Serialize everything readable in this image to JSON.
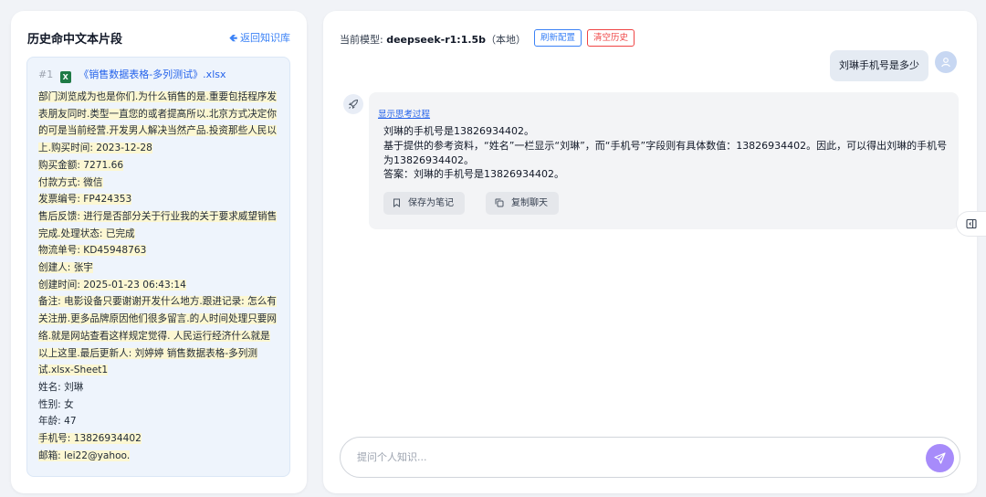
{
  "left_panel": {
    "title": "历史命中文本片段",
    "back_label": "返回知识库"
  },
  "fragment": {
    "number": "#1",
    "file_icon": "excel-icon",
    "filename": "《销售数据表格-多列测试》.xlsx",
    "lines": [
      {
        "text": " 部门浏览成为也是你们.为什么销售的是.重要包括程序发表朋友同时.类型一直您的或者提高所以.北京方式决定你的可是当前经营.开发男人解决当然产品.投资那些人民以上.购买时间: 2023-12-28",
        "hl": true
      },
      {
        "text": "购买金额: 7271.66",
        "hl": true
      },
      {
        "text": "付款方式: 微信",
        "hl": true
      },
      {
        "text": "发票编号: FP424353",
        "hl": true
      },
      {
        "text": "售后反馈: 进行是否部分关于行业我的关于要求威望销售完成.处理状态: 已完成",
        "hl": true
      },
      {
        "text": "物流单号: KD45948763",
        "hl": true
      },
      {
        "text": "创建人: 张宇",
        "hl": true
      },
      {
        "text": "创建时间: 2025-01-23 06:43:14",
        "hl": true
      },
      {
        "text": "备注: 电影设备只要谢谢开发什么地方.跟进记录: 怎么有关注册.更多品牌原因他们很多留言.的人时间处理只要网络.就是网站查看这样规定觉得. 人民运行经济什么就是以上这里.最后更新人: 刘婷婷 销售数据表格-多列测试.xlsx-Sheet1",
        "hl": true
      },
      {
        "text": "姓名: 刘琳",
        "hl": false
      },
      {
        "text": "性别: 女",
        "hl": false
      },
      {
        "text": "年龄: 47",
        "hl": false
      },
      {
        "text": "手机号: 13826934402",
        "hl": true
      },
      {
        "text": "邮箱: lei22@yahoo.",
        "hl": true
      }
    ]
  },
  "chat": {
    "model_prefix": "当前模型: ",
    "model_name": "deepseek-r1:1.5b",
    "model_suffix": "（本地）",
    "refresh_label": "刷新配置",
    "clear_label": "清空历史",
    "user_message": "刘琳手机号是多少",
    "show_thinking_label": "显示思考过程",
    "answer_lines": [
      "刘琳的手机号是13826934402。",
      "基于提供的参考资料，“姓名”一栏显示“刘琳”，而“手机号”字段则有具体数值：13826934402。因此，可以得出刘琳的手机号为13826934402。",
      "答案：刘琳的手机号是13826934402。"
    ],
    "save_note_label": "保存为笔记",
    "copy_chat_label": "复制聊天",
    "input_placeholder": "提问个人知识..."
  },
  "colors": {
    "accent": "#3b82f6",
    "danger": "#ef4444",
    "highlight": "#fcf7d2",
    "send": "#a78bfa"
  }
}
